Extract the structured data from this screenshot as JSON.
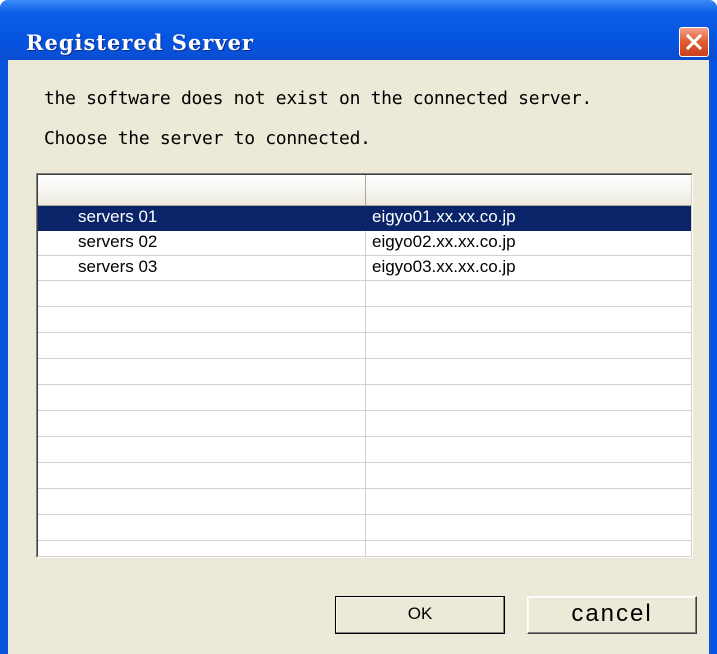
{
  "window": {
    "title": "Registered Server",
    "close_icon": "close-icon"
  },
  "message": {
    "line1": "the software does not exist on the connected server.",
    "line2": "Choose the server to connected."
  },
  "server_list": {
    "columns": [
      "",
      ""
    ],
    "rows": [
      {
        "name": "servers  01",
        "host": "eigyo01.xx.xx.co.jp",
        "selected": true
      },
      {
        "name": "servers  02",
        "host": "eigyo02.xx.xx.co.jp",
        "selected": false
      },
      {
        "name": "servers  03",
        "host": "eigyo03.xx.xx.co.jp",
        "selected": false
      }
    ]
  },
  "buttons": {
    "ok": "OK",
    "cancel": "cancel"
  },
  "colors": {
    "title_bar": "#0553df",
    "selection": "#0a246a",
    "dialog_face": "#ece9d8"
  }
}
